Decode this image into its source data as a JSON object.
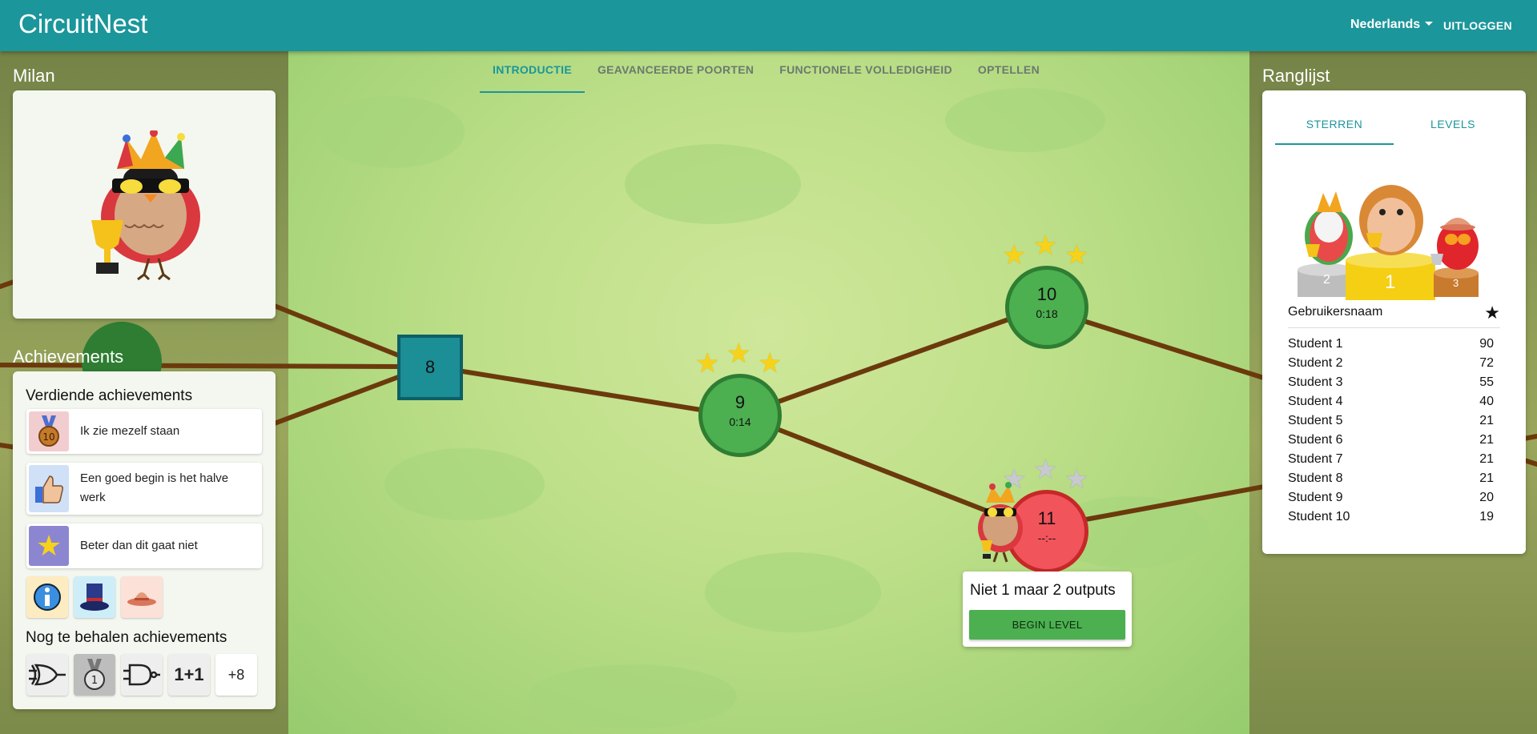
{
  "app": {
    "brand": "CircuitNest",
    "language": "Nederlands",
    "logout": "UITLOGGEN"
  },
  "world_tabs": [
    {
      "label": "INTRODUCTIE",
      "active": true
    },
    {
      "label": "GEAVANCEERDE POORTEN",
      "active": false
    },
    {
      "label": "FUNCTIONELE VOLLEDIGHEID",
      "active": false
    },
    {
      "label": "OPTELLEN",
      "active": false
    }
  ],
  "profile": {
    "name": "Milan"
  },
  "achievements": {
    "title": "Achievements",
    "earned_title": "Verdiende achievements",
    "earned": [
      {
        "label": "Ik zie mezelf staan",
        "icon": "medal-10-icon",
        "color": "#f1cdd0"
      },
      {
        "label": "Een goed begin is het halve werk",
        "icon": "thumbs-up-icon",
        "color": "#cfe0f7"
      },
      {
        "label": "Beter dan dit gaat niet",
        "icon": "star-icon",
        "color": "#8c86d0"
      }
    ],
    "earned_badges": [
      {
        "icon": "info-icon",
        "color": "#fdebc2"
      },
      {
        "icon": "top-hat-icon",
        "color": "#cdeef8"
      },
      {
        "icon": "sun-hat-icon",
        "color": "#fbe1d7"
      }
    ],
    "pending_title": "Nog te behalen achievements",
    "pending_badges": [
      {
        "icon": "xor-gate-icon",
        "text": ""
      },
      {
        "icon": "medal-1-icon",
        "text": ""
      },
      {
        "icon": "nand-gate-icon",
        "text": ""
      },
      {
        "icon": "one-plus-one-icon",
        "text": "1+1"
      }
    ],
    "pending_more": "+8"
  },
  "levels": [
    {
      "number": "8",
      "time": "",
      "state": "gate"
    },
    {
      "number": "9",
      "time": "0:14",
      "stars": 3
    },
    {
      "number": "10",
      "time": "0:18",
      "stars": 3
    },
    {
      "number": "11",
      "time": "--:--",
      "stars": 0
    }
  ],
  "level_popup": {
    "title": "Niet 1 maar 2 outputs",
    "button": "BEGIN LEVEL"
  },
  "leaderboard": {
    "title": "Ranglijst",
    "tabs": [
      {
        "label": "STERREN",
        "active": true
      },
      {
        "label": "LEVELS",
        "active": false
      }
    ],
    "podium": [
      "2",
      "1",
      "3"
    ],
    "header_name": "Gebruikersnaam",
    "rows": [
      {
        "name": "Student 1",
        "score": "90"
      },
      {
        "name": "Student 2",
        "score": "72"
      },
      {
        "name": "Student 3",
        "score": "55"
      },
      {
        "name": "Student 4",
        "score": "40"
      },
      {
        "name": "Student 5",
        "score": "21"
      },
      {
        "name": "Student 6",
        "score": "21"
      },
      {
        "name": "Student 7",
        "score": "21"
      },
      {
        "name": "Student 8",
        "score": "21"
      },
      {
        "name": "Student 9",
        "score": "20"
      },
      {
        "name": "Student 10",
        "score": "19"
      }
    ]
  },
  "colors": {
    "primary": "#1b969b",
    "completed": "#4caf50",
    "locked": "#f2545b",
    "star": "#f7d21b"
  }
}
